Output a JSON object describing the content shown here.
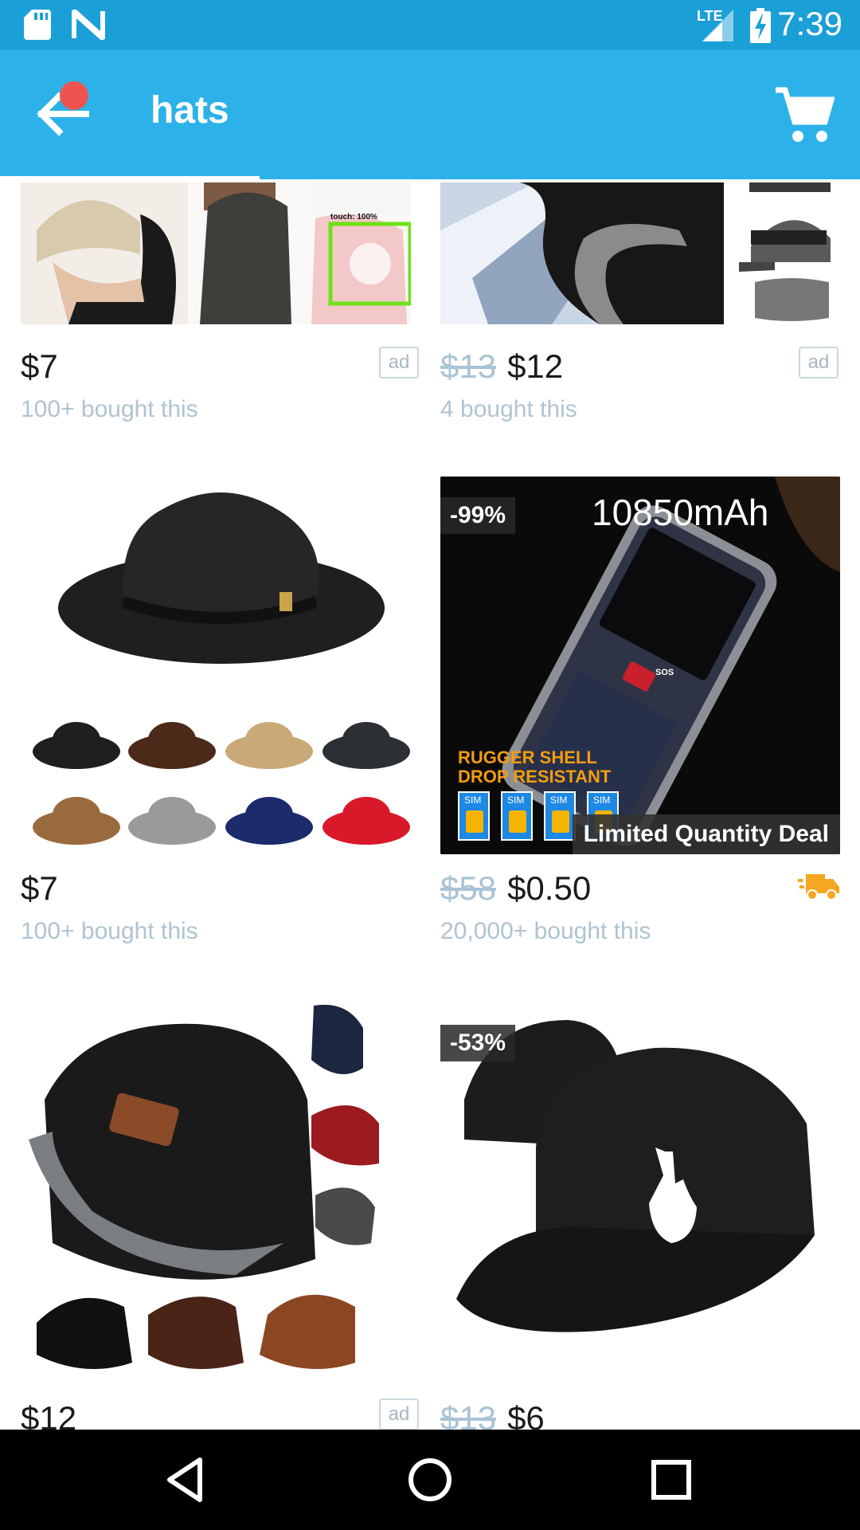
{
  "status_bar": {
    "time": "7:39",
    "network": "LTE",
    "icons": [
      "sd-card-icon",
      "n-logo-icon",
      "lte-signal-icon",
      "battery-charging-icon"
    ]
  },
  "app_bar": {
    "title": "hats",
    "back_icon": "arrow-left-icon",
    "cart_icon": "shopping-cart-icon",
    "accent_color": "#2CB2E8",
    "notification_color": "#EF5350"
  },
  "products": [
    {
      "price": "$7",
      "original_price": "",
      "bought": "100+ bought this",
      "ad": "ad",
      "discount": "",
      "image_desc": "knit-beanies",
      "overlay_label": "touch: 100%"
    },
    {
      "price": "$12",
      "original_price": "$13",
      "bought": "4 bought this",
      "ad": "ad",
      "discount": "",
      "image_desc": "fleece-hat-set"
    },
    {
      "price": "$7",
      "original_price": "",
      "bought": "100+ bought this",
      "ad": "",
      "discount": "",
      "image_desc": "felt-fedora"
    },
    {
      "price": "$0.50",
      "original_price": "$58",
      "bought": "20,000+ bought this",
      "ad": "",
      "discount": "-99%",
      "image_desc": "rugged-phone",
      "image_headline": "10850mAh",
      "image_tagline_1": "RUGGER SHELL",
      "image_tagline_2": "DROP RESISTANT",
      "sim_label": "SIM",
      "sos_label": "SOS",
      "banner": "Limited Quantity Deal",
      "shipping_icon": "delivery-truck-icon"
    },
    {
      "price": "$12",
      "original_price": "",
      "bought": "",
      "ad": "ad",
      "discount": "",
      "image_desc": "fleece-lined-beanies"
    },
    {
      "price": "$6",
      "original_price": "$13",
      "bought": "",
      "ad": "",
      "discount": "-53%",
      "image_desc": "snapback-cap"
    }
  ],
  "nav_bar": {
    "icons": [
      "back-triangle-icon",
      "home-circle-icon",
      "recents-square-icon"
    ]
  }
}
